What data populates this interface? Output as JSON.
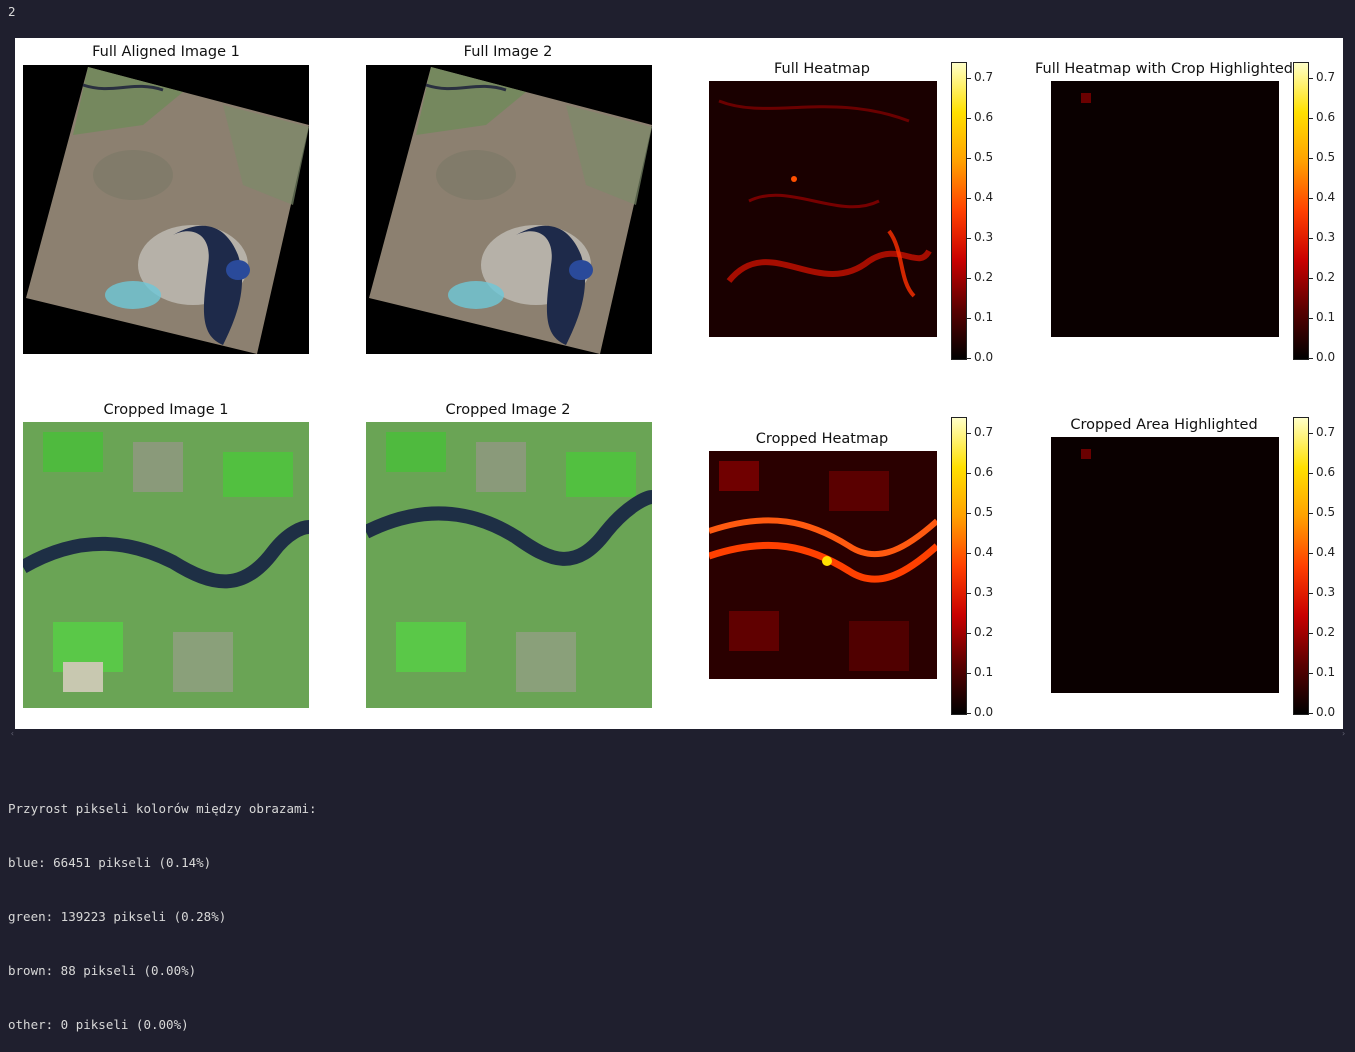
{
  "output_top_line": "2",
  "figure": {
    "titles": {
      "full_aligned_1": "Full Aligned Image 1",
      "full_image_2": "Full Image 2",
      "full_heatmap": "Full Heatmap",
      "full_heatmap_crop": "Full Heatmap with Crop Highlighted",
      "cropped_1": "Cropped Image 1",
      "cropped_2": "Cropped Image 2",
      "cropped_heatmap": "Cropped Heatmap",
      "cropped_area": "Cropped Area Highlighted"
    },
    "colorbar_ticks": [
      "0.7",
      "0.6",
      "0.5",
      "0.4",
      "0.3",
      "0.2",
      "0.1",
      "0.0"
    ],
    "colorbar_range": [
      0,
      0.74
    ],
    "colormap": [
      "#000000",
      "#5a0000",
      "#c80000",
      "#ff4000",
      "#ffa000",
      "#ffe000",
      "#ffffc8"
    ]
  },
  "summary": {
    "header": "Przyrost pikseli kolorów między obrazami:",
    "lines": [
      "blue: 66451 pikseli (0.14%)",
      "green: 139223 pikseli (0.28%)",
      "brown: 88 pikseli (0.00%)",
      "other: 0 pikseli (0.00%)"
    ]
  },
  "scroll": {
    "left_arrow": "‹",
    "right_arrow": "›"
  }
}
